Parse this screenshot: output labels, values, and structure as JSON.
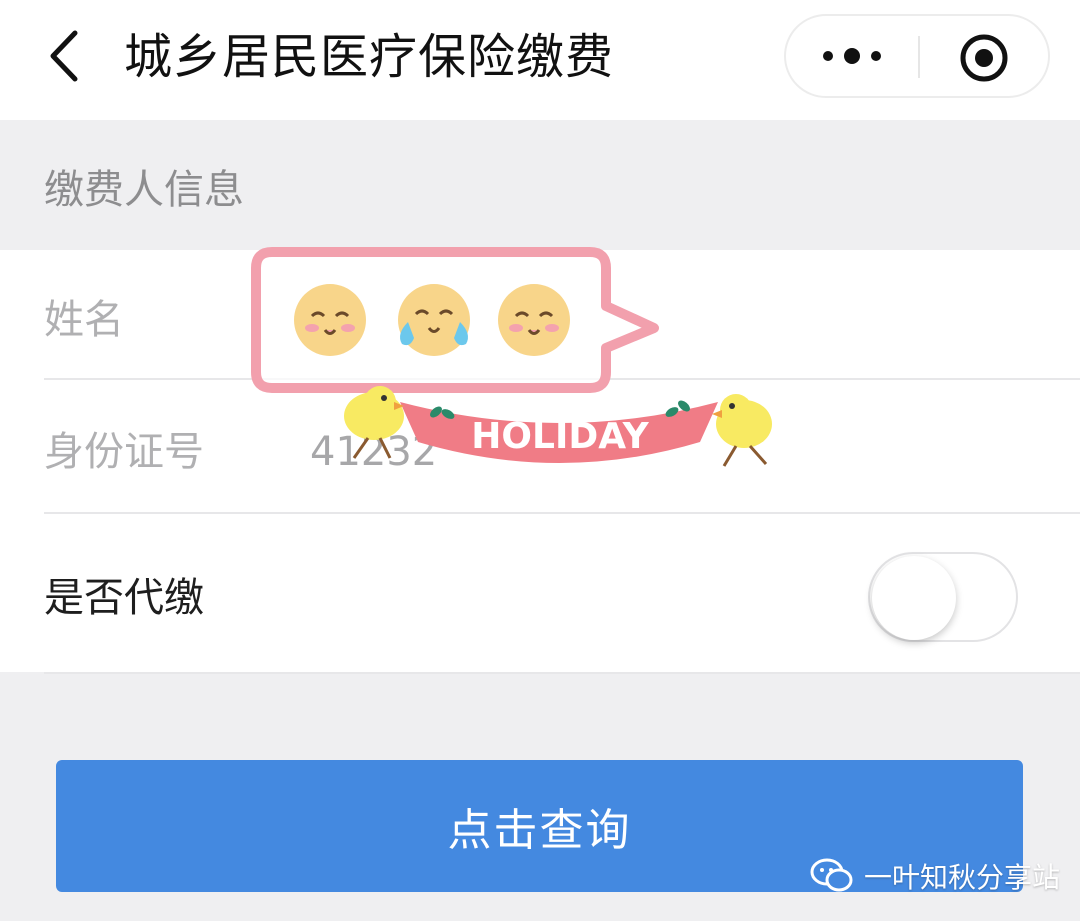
{
  "nav": {
    "title": "城乡居民医疗保险缴费",
    "back_icon": "chevron-left-icon",
    "more_icon": "more-dots-icon",
    "close_icon": "target-circle-icon"
  },
  "section": {
    "title": "缴费人信息"
  },
  "form": {
    "name_label": "姓名",
    "id_label": "身份证号",
    "id_value": "41232",
    "proxy_label": "是否代缴",
    "proxy_enabled": false
  },
  "button": {
    "query_label": "点击查询",
    "color": "#4489e0"
  },
  "sticker": {
    "banner_text": "HOLIDAY"
  },
  "watermark": {
    "text": "一叶知秋分享站",
    "icon": "wechat-icon"
  }
}
